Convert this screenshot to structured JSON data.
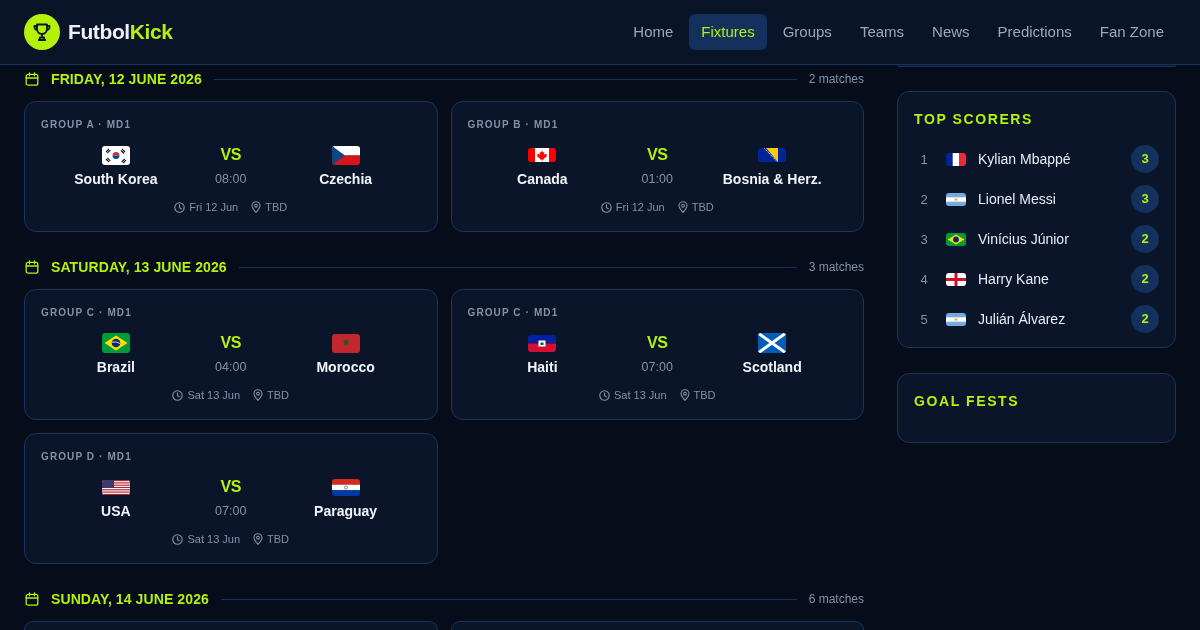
{
  "header": {
    "brand": {
      "name": "Futbol",
      "accent": "Kick"
    },
    "nav": [
      {
        "label": "Home",
        "selected": false
      },
      {
        "label": "Fixtures",
        "selected": true
      },
      {
        "label": "Groups",
        "selected": false
      },
      {
        "label": "Teams",
        "selected": false
      },
      {
        "label": "News",
        "selected": false
      },
      {
        "label": "Predictions",
        "selected": false
      },
      {
        "label": "Fan Zone",
        "selected": false
      }
    ]
  },
  "fixtures": [
    {
      "date": "FRIDAY, 12 JUNE 2026",
      "count": "2 matches",
      "matches": [
        {
          "kind": "card",
          "group": "GROUP A · MD1",
          "home": "South Korea",
          "away": "Czechia",
          "vs": "VS",
          "time": "08:00",
          "day": "Fri 12 Jun",
          "venue": "TBD"
        },
        {
          "kind": "card",
          "group": "GROUP B · MD1",
          "home": "Canada",
          "away": "Bosnia & Herz.",
          "vs": "VS",
          "time": "01:00",
          "day": "Fri 12 Jun",
          "venue": "TBD"
        }
      ]
    },
    {
      "date": "SATURDAY, 13 JUNE 2026",
      "count": "3 matches",
      "matches": [
        {
          "kind": "card",
          "group": "GROUP C · MD1",
          "home": "Brazil",
          "away": "Morocco",
          "vs": "VS",
          "time": "04:00",
          "day": "Sat 13 Jun",
          "venue": "TBD"
        },
        {
          "kind": "card",
          "group": "GROUP C · MD1",
          "home": "Haiti",
          "away": "Scotland",
          "vs": "VS",
          "time": "07:00",
          "day": "Sat 13 Jun",
          "venue": "TBD"
        },
        {
          "kind": "card",
          "group": "GROUP D · MD1",
          "home": "USA",
          "away": "Paraguay",
          "vs": "VS",
          "time": "07:00",
          "day": "Sat 13 Jun",
          "venue": "TBD"
        }
      ]
    },
    {
      "date": "SUNDAY, 14 JUNE 2026",
      "count": "6 matches",
      "matches": [
        {
          "kind": "cut_off"
        },
        {
          "kind": "cut_off"
        }
      ]
    }
  ],
  "sidebar": {
    "cards": [
      {
        "kind": "cut_off"
      },
      {
        "kind": "scorers",
        "title": "TOP SCORERS",
        "rows": [
          {
            "rank": "1",
            "name": "Kylian Mbappé",
            "goals": "3"
          },
          {
            "rank": "2",
            "name": "Lionel Messi",
            "goals": "3"
          },
          {
            "rank": "3",
            "name": "Vinícius Júnior",
            "goals": "2"
          },
          {
            "rank": "4",
            "name": "Harry Kane",
            "goals": "2"
          },
          {
            "rank": "5",
            "name": "Julián Álvarez",
            "goals": "2"
          }
        ]
      },
      {
        "kind": "empty",
        "title": "GOAL FESTS"
      }
    ]
  }
}
